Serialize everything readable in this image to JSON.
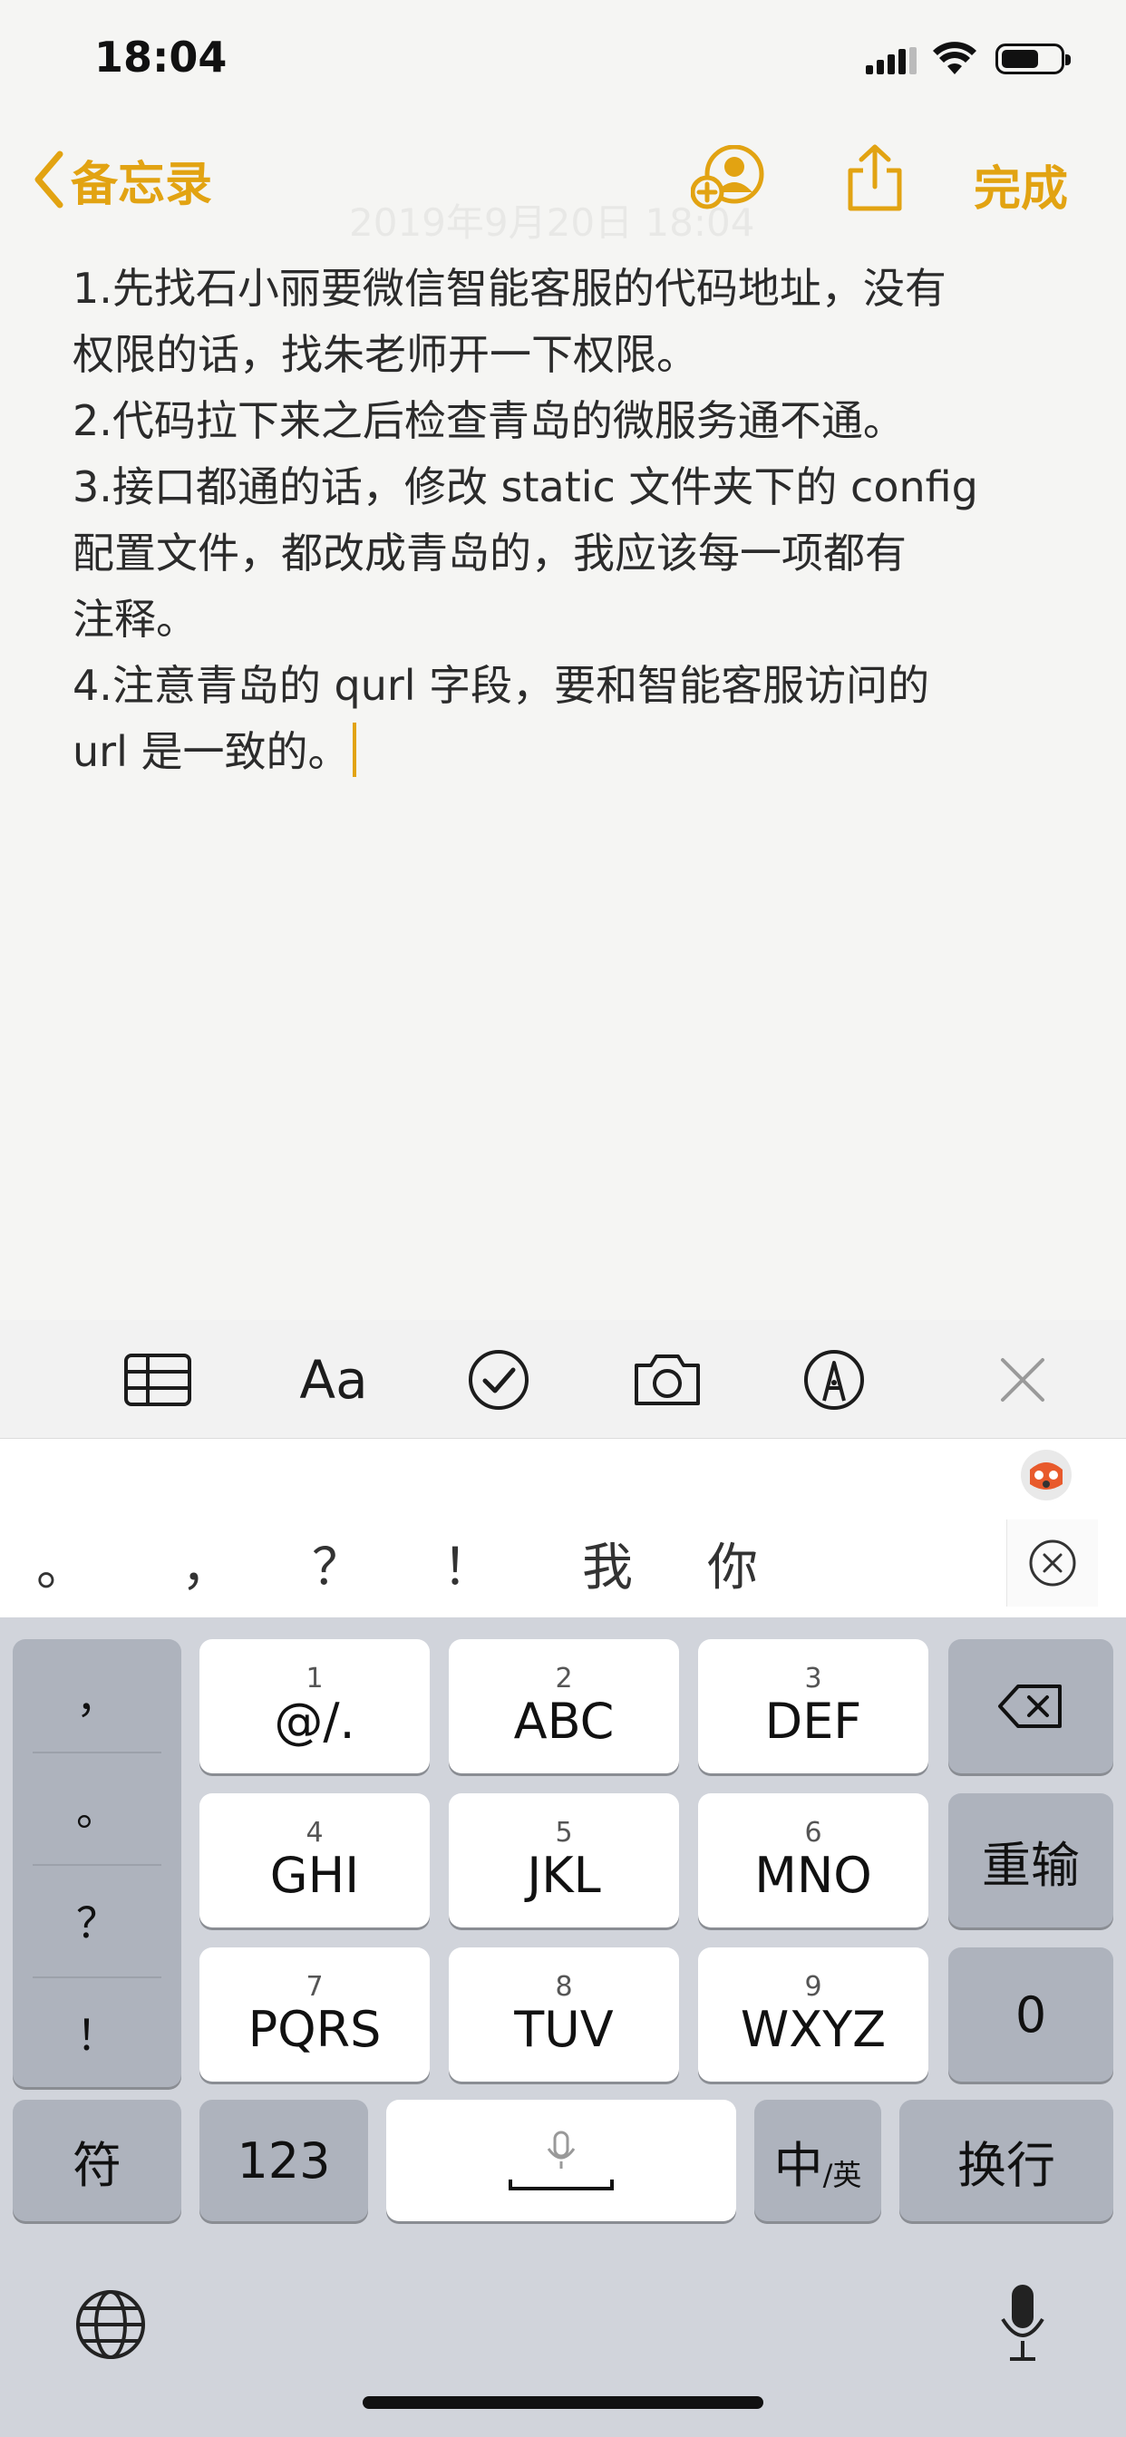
{
  "status_bar": {
    "time": "18:04"
  },
  "nav": {
    "back_label": "备忘录",
    "done_label": "完成",
    "faint_date": "2019年9月20日 18:04"
  },
  "note": {
    "lines": [
      "1.先找石小丽要微信智能客服的代码地址，没有",
      "权限的话，找朱老师开一下权限。",
      "2.代码拉下来之后检查青岛的微服务通不通。",
      "3.接口都通的话，修改 static 文件夹下的 config",
      "配置文件，都改成青岛的，我应该每一项都有",
      "注释。",
      "4.注意青岛的 qurl 字段，要和智能客服访问的",
      "url 是一致的。"
    ]
  },
  "toolbar": {
    "text_style_label": "Aa"
  },
  "candidates": [
    "。",
    "，",
    "？",
    "！",
    "我",
    "你"
  ],
  "keyboard": {
    "side_punct": [
      "，",
      "。",
      "？",
      "！"
    ],
    "keys": [
      {
        "num": "1",
        "label": "@/."
      },
      {
        "num": "2",
        "label": "ABC"
      },
      {
        "num": "3",
        "label": "DEF"
      },
      {
        "num": "4",
        "label": "GHI"
      },
      {
        "num": "5",
        "label": "JKL"
      },
      {
        "num": "6",
        "label": "MNO"
      },
      {
        "num": "7",
        "label": "PQRS"
      },
      {
        "num": "8",
        "label": "TUV"
      },
      {
        "num": "9",
        "label": "WXYZ"
      }
    ],
    "reenter_label": "重输",
    "zero_label": "0",
    "symbols_label": "符",
    "numbers_label": "123",
    "lang_main": "中",
    "lang_sub": "/英",
    "newline_label": "换行"
  },
  "colors": {
    "accent": "#e2a312",
    "paper": "#f5f5f3",
    "keyboard": "#d1d4db"
  }
}
